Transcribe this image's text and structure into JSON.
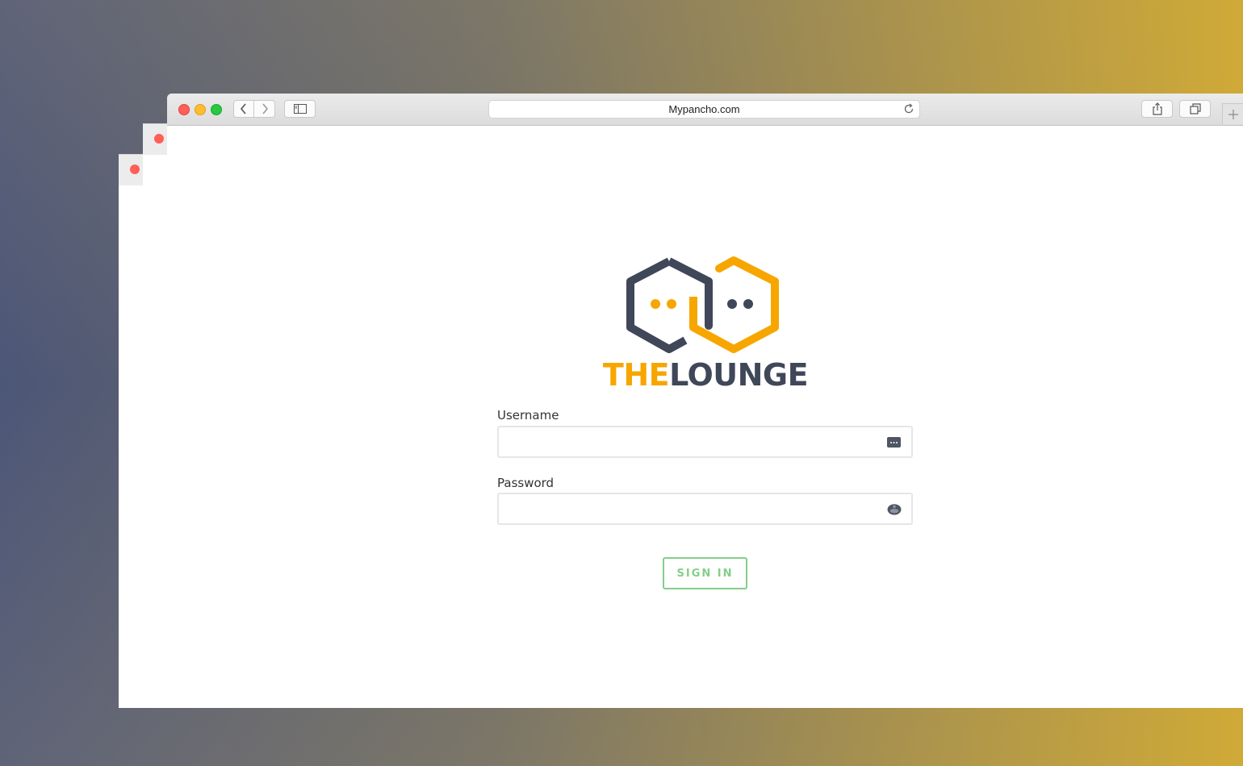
{
  "browser": {
    "address": "Mypancho.com"
  },
  "brand": {
    "the": "THE",
    "lounge": "LOUNGE",
    "colors": {
      "orange": "#f7a600",
      "navy": "#3f4759",
      "green": "#84ce88"
    }
  },
  "form": {
    "username_label": "Username",
    "username_value": "",
    "password_label": "Password",
    "password_value": "",
    "signin_label": "SIGN IN"
  },
  "icons": {
    "back": "chevron-left-icon",
    "forward": "chevron-right-icon",
    "sidebar": "sidebar-icon",
    "reload": "reload-icon",
    "share": "share-icon",
    "tabs": "tabs-icon",
    "new_tab": "plus-icon",
    "username_autofill": "autofill-card-icon",
    "password_autofill": "key-autofill-icon"
  }
}
